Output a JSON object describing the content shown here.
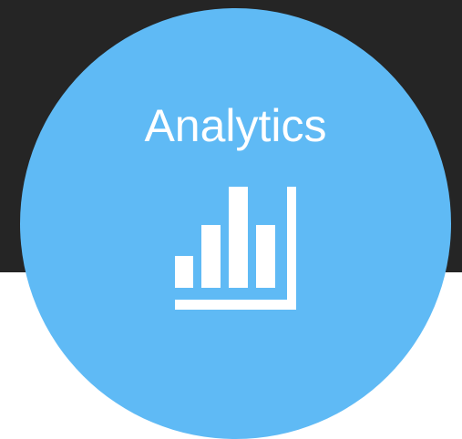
{
  "tile": {
    "label": "Analytics",
    "icon": "bar-chart-icon",
    "background_color": "#5fbaf5",
    "icon_color": "#ffffff"
  },
  "page": {
    "band_color": "#252525",
    "background_color": "#ffffff"
  }
}
